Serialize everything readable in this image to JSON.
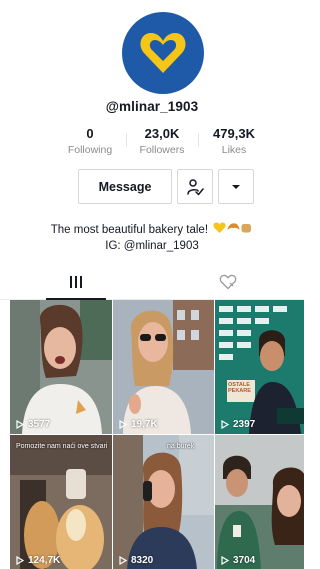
{
  "profile": {
    "username": "@mlinar_1903",
    "bio_line1": "The most beautiful bakery tale!",
    "bio_line2": "IG: @mlinar_1903"
  },
  "stats": [
    {
      "value": "0",
      "label": "Following"
    },
    {
      "value": "23,0K",
      "label": "Followers"
    },
    {
      "value": "479,3K",
      "label": "Likes"
    }
  ],
  "actions": {
    "message_label": "Message"
  },
  "tabs": [
    {
      "icon": "grid-icon",
      "active": true
    },
    {
      "icon": "liked-icon",
      "active": false
    }
  ],
  "videos": [
    {
      "views": "3577"
    },
    {
      "views": "19,7K"
    },
    {
      "views": "2397",
      "overlay_text": "OSTALE PEKARE"
    },
    {
      "views": "124,7K",
      "caption": "Pomozite nam naći ove stvari"
    },
    {
      "views": "8320",
      "caption": "na burek"
    },
    {
      "views": "3704"
    }
  ],
  "colors": {
    "avatar_bg": "#1f5aa8",
    "heart": "#f5c518",
    "muted_text": "#8a8b91"
  }
}
